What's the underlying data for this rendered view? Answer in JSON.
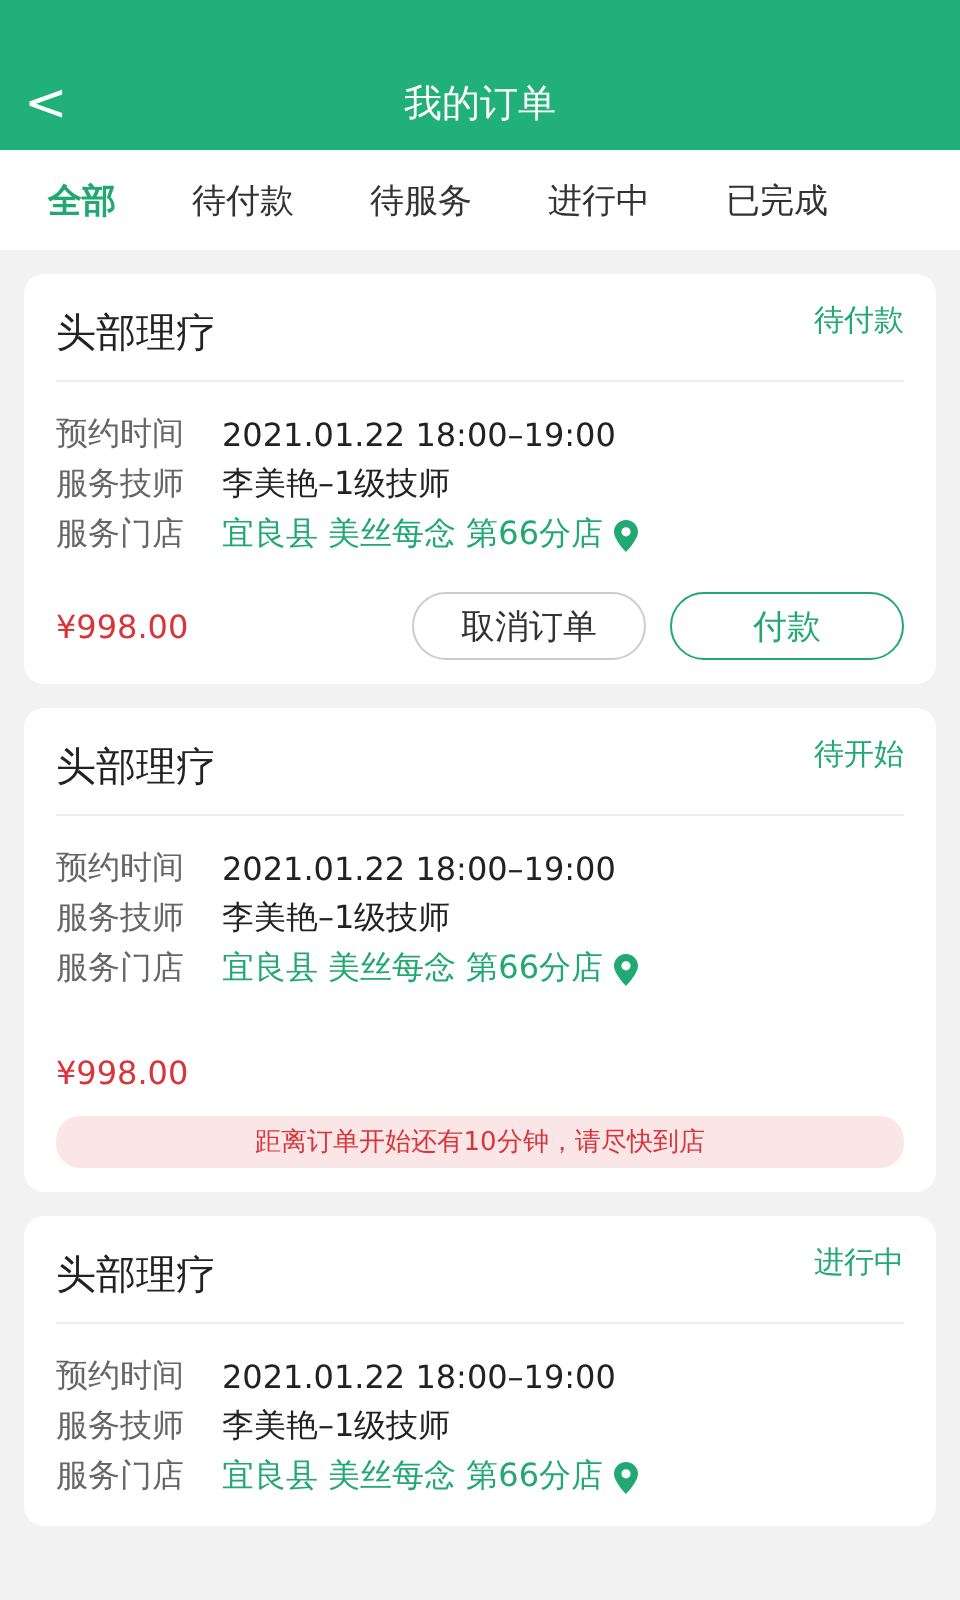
{
  "header": {
    "back": "<",
    "title": "我的订单"
  },
  "tabs": [
    {
      "label": "全部",
      "selected": true
    },
    {
      "label": "待付款",
      "selected": false
    },
    {
      "label": "待服务",
      "selected": false
    },
    {
      "label": "进行中",
      "selected": false
    },
    {
      "label": "已完成",
      "selected": false
    }
  ],
  "orders": [
    {
      "service": "头部理疗",
      "status": "待付款",
      "details": [
        {
          "label": "预约时间",
          "value": "2021.01.22 18:00–19:00",
          "kind": "text"
        },
        {
          "label": "服务技师",
          "value": "李美艳–1级技师",
          "kind": "text"
        },
        {
          "label": "服务门店",
          "value": "宜良县 美丝每念 第66分店",
          "kind": "store"
        }
      ],
      "price": "¥998.00",
      "buttons": [
        {
          "label": "取消订单",
          "kind": "outline"
        },
        {
          "label": "付款",
          "kind": "primary"
        }
      ]
    },
    {
      "service": "头部理疗",
      "status": "待开始",
      "details": [
        {
          "label": "预约时间",
          "value": "2021.01.22 18:00–19:00",
          "kind": "text"
        },
        {
          "label": "服务技师",
          "value": "李美艳–1级技师",
          "kind": "text"
        },
        {
          "label": "服务门店",
          "value": "宜良县 美丝每念 第66分店",
          "kind": "store"
        }
      ],
      "price": "¥998.00",
      "notice": "距离订单开始还有10分钟，请尽快到店"
    },
    {
      "service": "头部理疗",
      "status": "进行中",
      "details": [
        {
          "label": "预约时间",
          "value": "2021.01.22 18:00–19:00",
          "kind": "text"
        },
        {
          "label": "服务技师",
          "value": "李美艳–1级技师",
          "kind": "text"
        },
        {
          "label": "服务门店",
          "value": "宜良县 美丝每念 第66分店",
          "kind": "store"
        }
      ]
    }
  ]
}
